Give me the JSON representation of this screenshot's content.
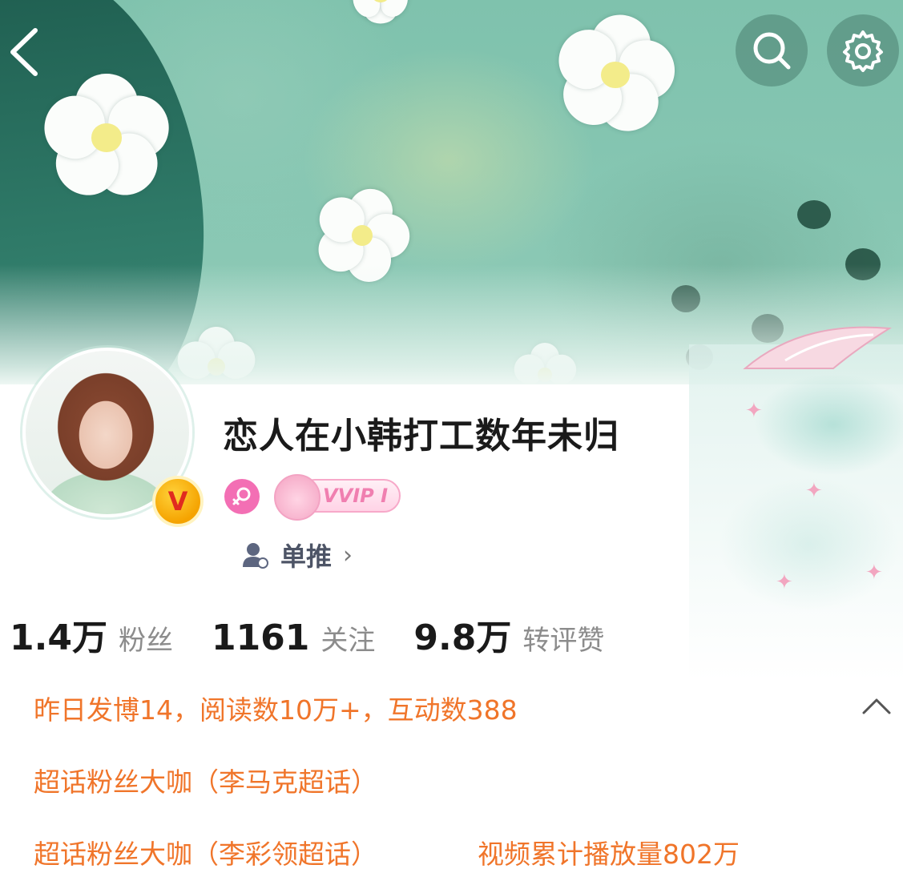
{
  "nav": {
    "back_icon": "chevron-left-icon",
    "search_icon": "search-icon",
    "settings_icon": "gear-icon"
  },
  "profile": {
    "username": "恋人在小韩打工数年未归",
    "gender_icon": "female-icon",
    "verified_badge": "V",
    "vip_badge": "VVIP I",
    "tag_label": "单推",
    "tag_icon": "user-icon"
  },
  "stats": [
    {
      "value": "1.4万",
      "label": "粉丝"
    },
    {
      "value": "1161",
      "label": "关注"
    },
    {
      "value": "9.8万",
      "label": "转评赞"
    }
  ],
  "info": {
    "line1": "昨日发博14，阅读数10万+，互动数388",
    "line2": "超话粉丝大咖（李马克超话）",
    "line3a": "超话粉丝大咖（李彩领超话）",
    "line3b": "视频累计播放量802万"
  },
  "colors": {
    "accent_orange": "#f0752a",
    "vip_pink": "#f07fb0",
    "verified_gold": "#f5a300"
  }
}
